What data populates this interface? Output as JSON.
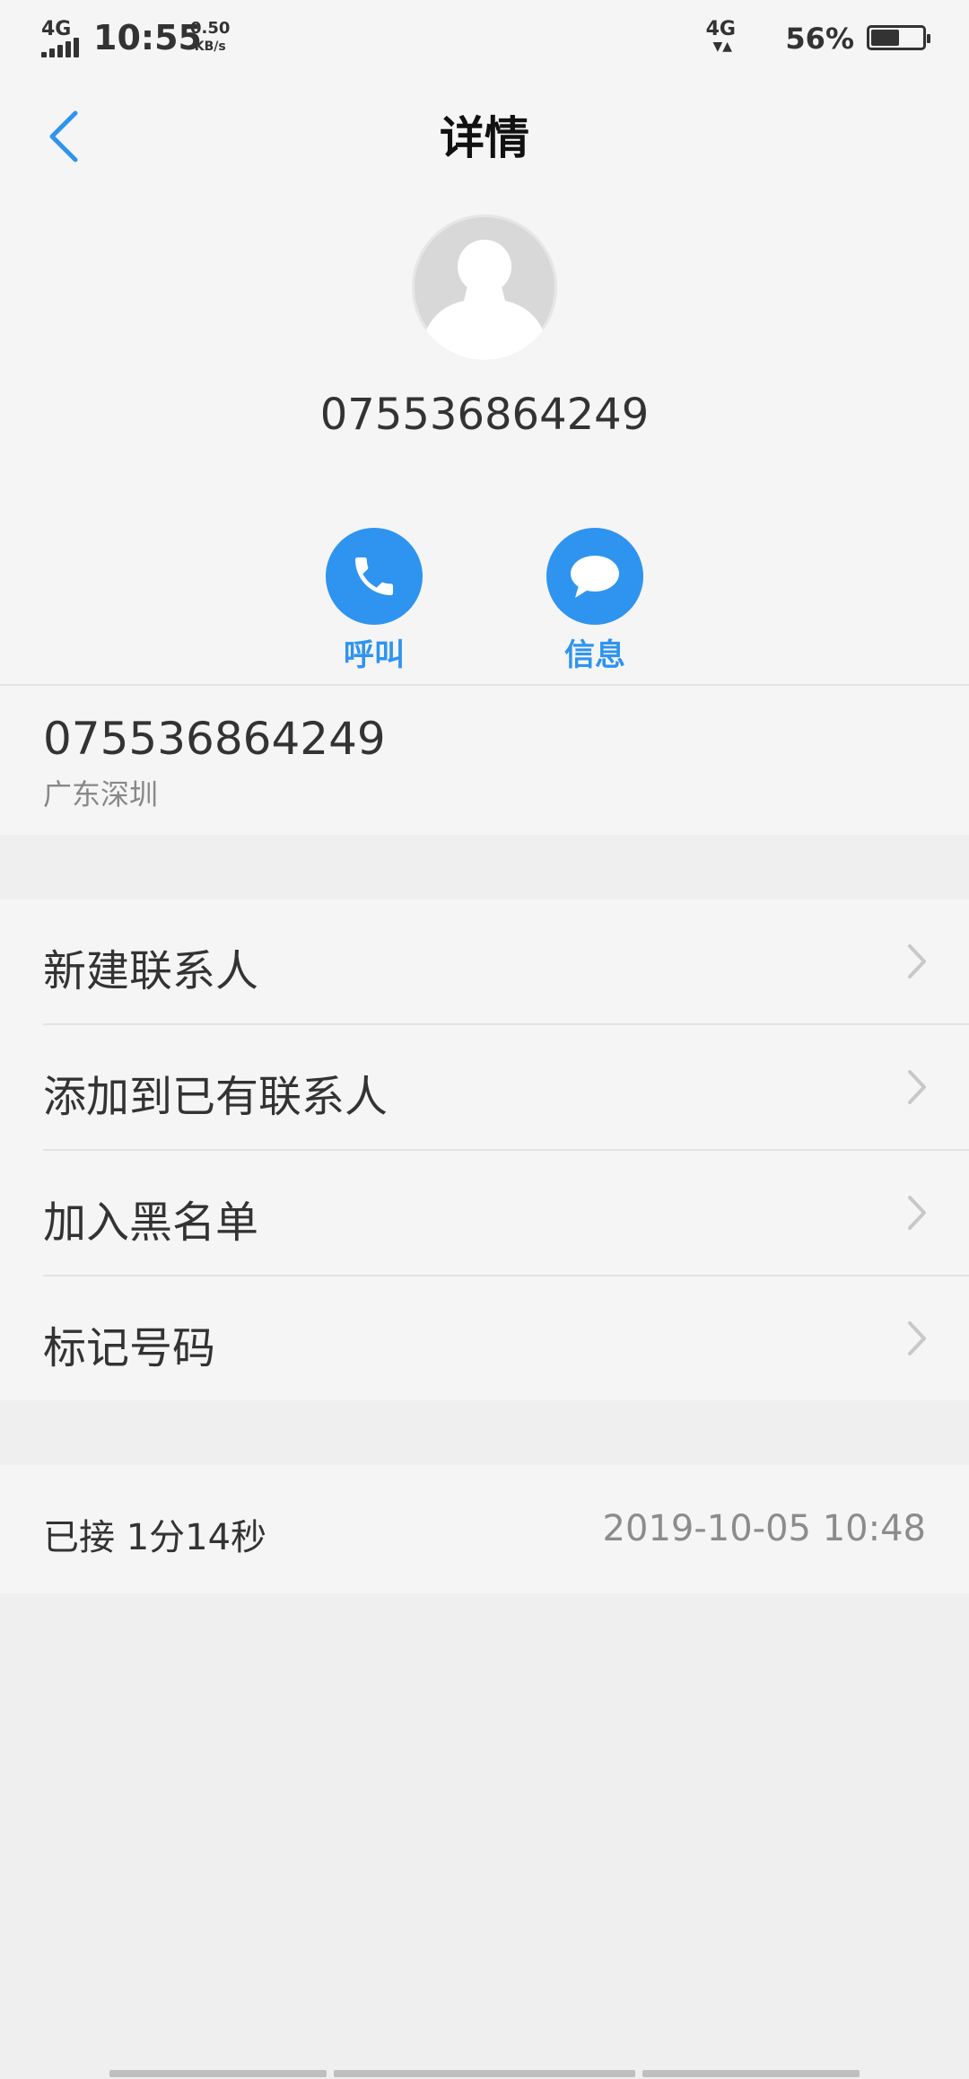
{
  "status_bar": {
    "network_left": "4G",
    "time": "10:55",
    "speed_value": "0.50",
    "speed_unit": "KB/s",
    "network_right": "4G",
    "battery_percent": "56%",
    "battery_level": 0.56
  },
  "header": {
    "title": "详情",
    "number": "075536864249"
  },
  "actions": {
    "call_label": "呼叫",
    "message_label": "信息"
  },
  "number_info": {
    "number": "075536864249",
    "location": "广东深圳"
  },
  "menu": {
    "items": [
      {
        "label": "新建联系人"
      },
      {
        "label": "添加到已有联系人"
      },
      {
        "label": "加入黑名单"
      },
      {
        "label": "标记号码"
      }
    ]
  },
  "call_record": {
    "status": "已接 1分14秒",
    "datetime": "2019-10-05 10:48"
  },
  "colors": {
    "accent": "#2f94ef",
    "background": "#efefef",
    "card": "#f5f5f5"
  }
}
